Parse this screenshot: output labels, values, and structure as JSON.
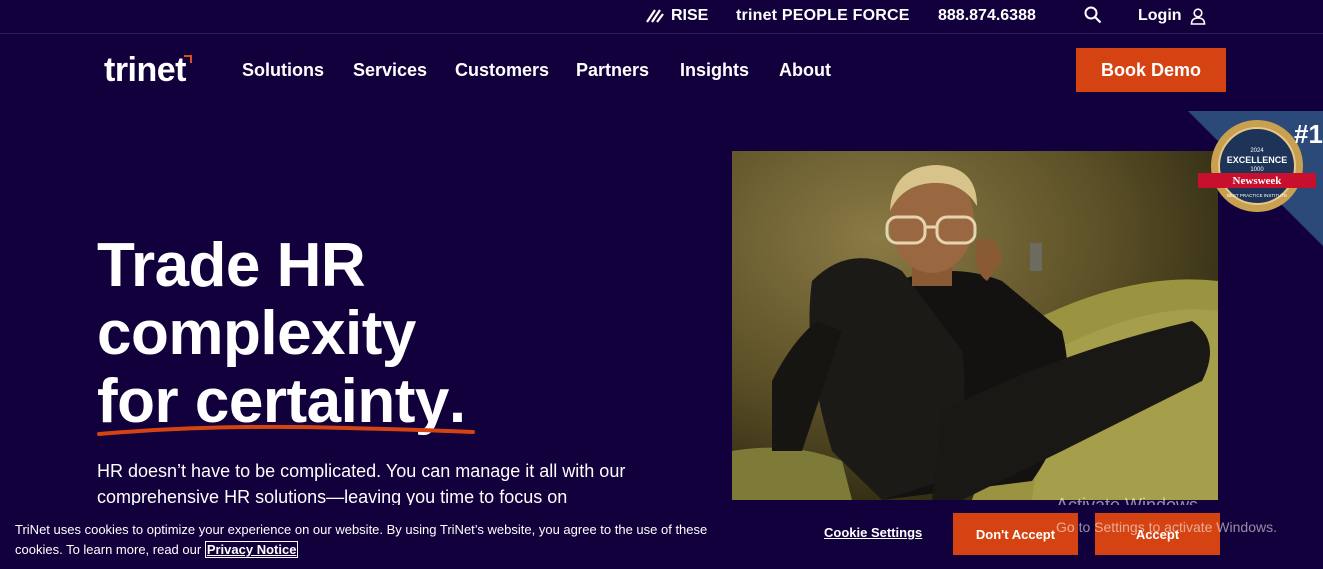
{
  "utility_bar": {
    "rise_label": "RISE",
    "people_force_brand": "trinet",
    "people_force_label": "PEOPLE FORCE",
    "phone": "888.874.6388",
    "login_label": "Login"
  },
  "nav": {
    "logo": "trinet",
    "items": [
      "Solutions",
      "Services",
      "Customers",
      "Partners",
      "Insights",
      "About"
    ],
    "cta_label": "Book Demo"
  },
  "hero": {
    "title_line1": "Trade HR",
    "title_line2": "complexity",
    "title_line3": "for certainty",
    "title_punct": ".",
    "subtitle": "HR doesn’t have to be complicated. You can manage it all with our comprehensive HR solutions—leaving you time to focus on"
  },
  "badge": {
    "rank": "#1",
    "year": "2024",
    "award": "EXCELLENCE",
    "count": "1000",
    "publisher": "Newsweek",
    "institute": "BEST PRACTICE INSTITUTE"
  },
  "cookie": {
    "text": "TriNet uses cookies to optimize your experience on our website. By using TriNet’s website, you agree to the use of these cookies. To learn more, read our",
    "privacy_link": "Privacy Notice",
    "settings_label": "Cookie Settings",
    "dont_accept_label": "Don't Accept",
    "accept_label": "Accept"
  },
  "watermark": {
    "line1": "Activate Windows",
    "line2": "Go to Settings to activate Windows."
  },
  "colors": {
    "background": "#11003b",
    "accent": "#d64312",
    "badge_blue": "#2b4a7a"
  }
}
